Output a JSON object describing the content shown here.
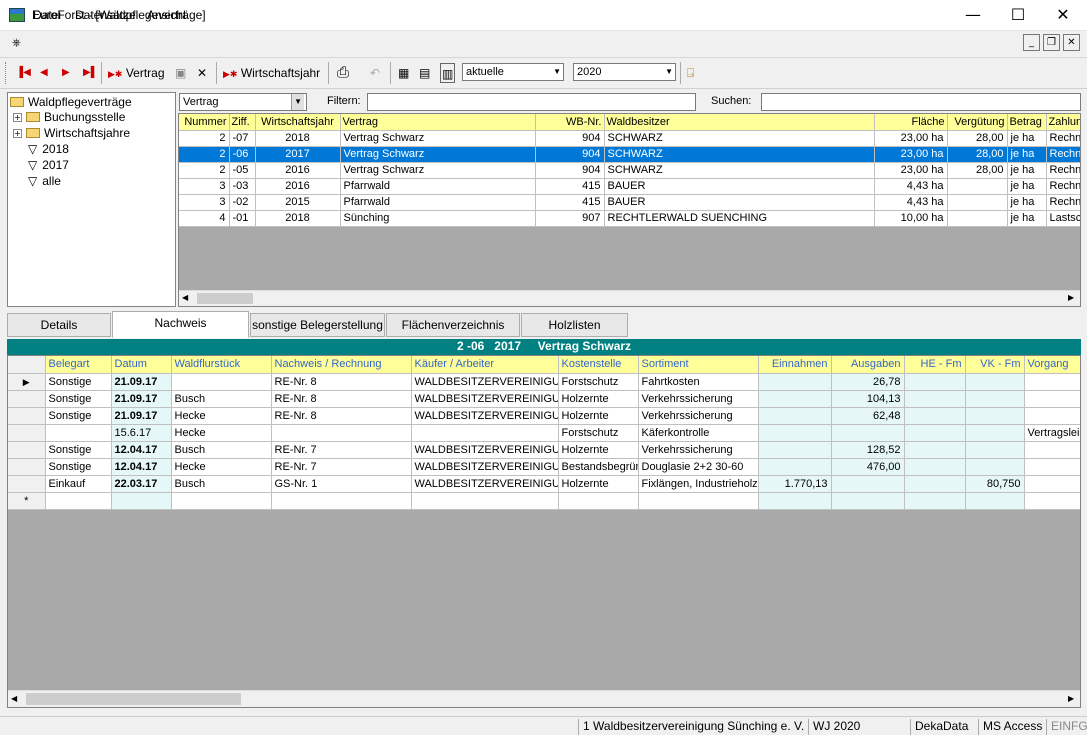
{
  "window": {
    "title": "EuroForst - [Waldpflegeverträge]",
    "minimize": "—",
    "maximize": "☐",
    "close": "✕"
  },
  "menu": {
    "items": [
      "Datei",
      "Datensätze",
      "Ansicht"
    ]
  },
  "toolbar": {
    "new_contract": "Vertrag",
    "new_year": "Wirtschaftsjahr",
    "filter_value": "aktuelle",
    "year_value": "2020"
  },
  "tree": {
    "root": "Waldpflegeverträge",
    "nodes": [
      "Buchungsstelle",
      "Wirtschaftsjahre",
      "2018",
      "2017",
      "alle"
    ]
  },
  "filterbar": {
    "type_value": "Vertrag",
    "filter_label": "Filtern:",
    "filter_value": "",
    "search_label": "Suchen:",
    "search_value": ""
  },
  "contracts": {
    "columns": [
      "Nummer",
      "Ziff.",
      "Wirtschaftsjahr",
      "Vertrag",
      "WB-Nr.",
      "Waldbesitzer",
      "Fläche",
      "Vergütung",
      "Betrag",
      "Zahlun"
    ],
    "rows": [
      [
        "2",
        "-07",
        "2018",
        "Vertrag Schwarz",
        "904",
        "SCHWARZ",
        "23,00 ha",
        "28,00",
        "je ha",
        "Rechn"
      ],
      [
        "2",
        "-06",
        "2017",
        "Vertrag Schwarz",
        "904",
        "SCHWARZ",
        "23,00 ha",
        "28,00",
        "je ha",
        "Rechn"
      ],
      [
        "2",
        "-05",
        "2016",
        "Vertrag Schwarz",
        "904",
        "SCHWARZ",
        "23,00 ha",
        "28,00",
        "je ha",
        "Rechn"
      ],
      [
        "3",
        "-03",
        "2016",
        "Pfarrwald",
        "415",
        "BAUER",
        "4,43 ha",
        "",
        "je ha",
        "Rechn"
      ],
      [
        "3",
        "-02",
        "2015",
        "Pfarrwald",
        "415",
        "BAUER",
        "4,43 ha",
        "",
        "je ha",
        "Rechn"
      ],
      [
        "4",
        "-01",
        "2018",
        "Sünching",
        "907",
        "RECHTLERWALD SUENCHING",
        "10,00 ha",
        "",
        "je ha",
        "Lastsc"
      ]
    ],
    "selected_row": 1
  },
  "tabs": [
    "Details",
    "Nachweis",
    "sonstige Belegerstellung",
    "Flächenverzeichnis",
    "Holzlisten"
  ],
  "active_tab": 1,
  "banner": "2 -06   2017     Vertrag Schwarz",
  "details": {
    "columns": [
      "Belegart",
      "Datum",
      "Waldflurstück",
      "Nachweis / Rechnung",
      "Käufer / Arbeiter",
      "Kostenstelle",
      "Sortiment",
      "Einnahmen",
      "Ausgaben",
      "HE - Fm",
      "VK - Fm",
      "Vorgang"
    ],
    "rows": [
      [
        "Sonstige",
        "21.09.17",
        "",
        "RE-Nr. 8",
        "WALDBESITZERVEREINIGUNG",
        "Forstschutz",
        "Fahrtkosten",
        "",
        "26,78",
        "",
        "",
        ""
      ],
      [
        "Sonstige",
        "21.09.17",
        "Busch",
        "RE-Nr. 8",
        "WALDBESITZERVEREINIGUNG",
        "Holzernte",
        "Verkehrssicherung",
        "",
        "104,13",
        "",
        "",
        ""
      ],
      [
        "Sonstige",
        "21.09.17",
        "Hecke",
        "RE-Nr. 8",
        "WALDBESITZERVEREINIGUNG",
        "Holzernte",
        "Verkehrssicherung",
        "",
        "62,48",
        "",
        "",
        ""
      ],
      [
        "",
        "15.6.17",
        "Hecke",
        "",
        "",
        "Forstschutz",
        "Käferkontrolle",
        "",
        "",
        "",
        "",
        "Vertragsleistung"
      ],
      [
        "Sonstige",
        "12.04.17",
        "Busch",
        "RE-Nr. 7",
        "WALDBESITZERVEREINIGUNG",
        "Holzernte",
        "Verkehrssicherung",
        "",
        "128,52",
        "",
        "",
        ""
      ],
      [
        "Sonstige",
        "12.04.17",
        "Hecke",
        "RE-Nr. 7",
        "WALDBESITZERVEREINIGUNG",
        "Bestandsbegründung",
        "Douglasie 2+2 30-60",
        "",
        "476,00",
        "",
        "",
        ""
      ],
      [
        "Einkauf",
        "22.03.17",
        "Busch",
        "GS-Nr. 1",
        "WALDBESITZERVEREINIGUNG",
        "Holzernte",
        "Fixlängen, Industrieholz lang",
        "1.770,13",
        "",
        "",
        "80,750",
        ""
      ]
    ],
    "bold_dates": [
      true,
      true,
      true,
      false,
      true,
      true,
      true
    ],
    "new_row_marker": "*"
  },
  "status": {
    "org": "1 Waldbesitzervereinigung Sünching e. V.",
    "wj": "WJ 2020",
    "db": "DekaData",
    "engine": "MS Access",
    "mode": "EINFG"
  }
}
